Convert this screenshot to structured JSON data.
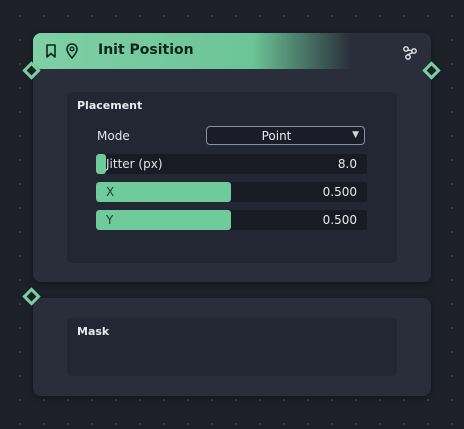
{
  "nodes": {
    "init_position": {
      "title": "Init Position",
      "placement": {
        "title": "Placement",
        "mode_label": "Mode",
        "mode_value": "Point",
        "sliders": [
          {
            "label": "Jitter (px)",
            "value": "8.0",
            "fill_fraction": 0.04
          },
          {
            "label": "X",
            "value": "0.500",
            "fill_fraction": 0.5
          },
          {
            "label": "Y",
            "value": "0.500",
            "fill_fraction": 0.5
          }
        ]
      }
    },
    "mask": {
      "title": "Mask"
    }
  },
  "icons": {
    "bookmark": "bookmark-icon",
    "location": "location-pin-icon",
    "graph": "graph-nodes-icon",
    "dropdown": "▼"
  },
  "colors": {
    "accent": "#6fcb9c",
    "header_start": "#7fd0a5",
    "node_bg": "#2a2e3a",
    "panel_bg": "#232733",
    "canvas_bg": "#1d2029"
  }
}
